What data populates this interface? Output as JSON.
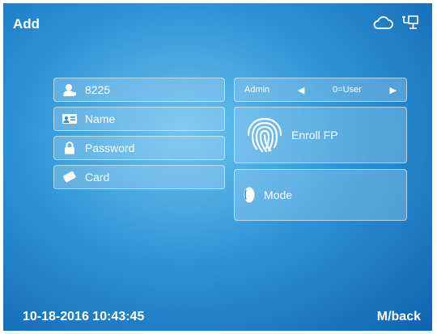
{
  "header": {
    "title": "Add",
    "icons": [
      "cloud-icon",
      "network-icon"
    ]
  },
  "form": {
    "user_id": "8225",
    "name_label": "Name",
    "password_label": "Password",
    "card_label": "Card"
  },
  "role": {
    "label": "Admin",
    "left_arrow": "◀",
    "value": "0=User",
    "right_arrow": "▶"
  },
  "enroll": {
    "label": "Enroll FP"
  },
  "mode": {
    "label": "Mode"
  },
  "footer": {
    "datetime": "10-18-2016 10:43:45",
    "back_label": "M/back"
  },
  "colors": {
    "text": "#ffffff",
    "background_center": "#6fc4ee",
    "background_edge": "#0f63b0"
  }
}
